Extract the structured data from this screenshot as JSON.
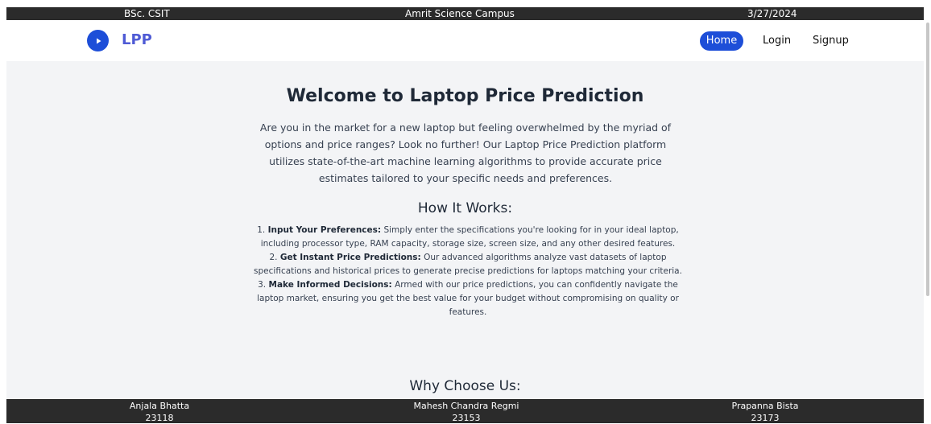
{
  "topbar": {
    "program": "BSc. CSIT",
    "campus": "Amrit Science Campus",
    "date": "3/27/2024"
  },
  "navbar": {
    "brand": "LPP",
    "links": {
      "home": "Home",
      "login": "Login",
      "signup": "Signup"
    },
    "accent_color": "#1d4ed8"
  },
  "main": {
    "title": "Welcome to Laptop Price Prediction",
    "intro": "Are you in the market for a new laptop but feeling overwhelmed by the myriad of options and price ranges? Look no further! Our Laptop Price Prediction platform utilizes state-of-the-art machine learning algorithms to provide accurate price estimates tailored to your specific needs and preferences.",
    "how_heading": "How It Works:",
    "steps": [
      {
        "number": "1.",
        "title": "Input Your Preferences:",
        "text": "Simply enter the specifications you're looking for in your ideal laptop, including processor type, RAM capacity, storage size, screen size, and any other desired features."
      },
      {
        "number": "2.",
        "title": "Get Instant Price Predictions:",
        "text": "Our advanced algorithms analyze vast datasets of laptop specifications and historical prices to generate precise predictions for laptops matching your criteria."
      },
      {
        "number": "3.",
        "title": "Make Informed Decisions:",
        "text": "Armed with our price predictions, you can confidently navigate the laptop market, ensuring you get the best value for your budget without compromising on quality or features."
      }
    ],
    "why_heading": "Why Choose Us:"
  },
  "footer": {
    "members": [
      {
        "name": "Anjala Bhatta",
        "id": "23118"
      },
      {
        "name": "Mahesh Chandra Regmi",
        "id": "23153"
      },
      {
        "name": "Prapanna Bista",
        "id": "23173"
      }
    ]
  }
}
